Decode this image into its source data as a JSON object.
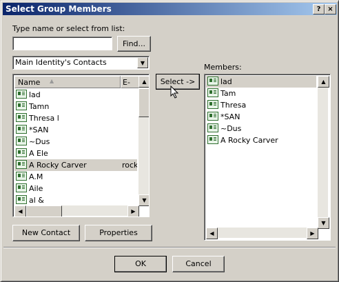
{
  "window": {
    "title": "Select Group Members",
    "help_label": "?",
    "close_label": "×"
  },
  "search": {
    "label": "Type name or select from list:",
    "value": "",
    "find_label": "Find..."
  },
  "addressbook": {
    "selected": "Main Identity's Contacts",
    "dropdown_glyph": "▼"
  },
  "contacts": {
    "columns": [
      "Name",
      "E-Ma"
    ],
    "sort_glyph": "▲",
    "rows": [
      {
        "name": "lad",
        "email": ""
      },
      {
        "name": "Tamn",
        "email": ""
      },
      {
        "name": "Thresa l",
        "email": ""
      },
      {
        "name": "*SAN",
        "email": ""
      },
      {
        "name": "~Dus",
        "email": ""
      },
      {
        "name": "A Ele",
        "email": ""
      },
      {
        "name": "A Rocky Carver",
        "email": "rocky"
      },
      {
        "name": "A.M",
        "email": ""
      },
      {
        "name": "Aile",
        "email": ""
      },
      {
        "name": "al &",
        "email": ""
      }
    ]
  },
  "select_button": "Select ->",
  "members": {
    "label": "Members:",
    "rows": [
      "lad",
      "Tam",
      "Thresa",
      "*SAN",
      "~Dus",
      "A Rocky Carver"
    ]
  },
  "buttons": {
    "new_contact": "New Contact",
    "properties": "Properties",
    "ok": "OK",
    "cancel": "Cancel"
  },
  "scroll": {
    "up": "▲",
    "down": "▼",
    "left": "◀",
    "right": "▶"
  }
}
